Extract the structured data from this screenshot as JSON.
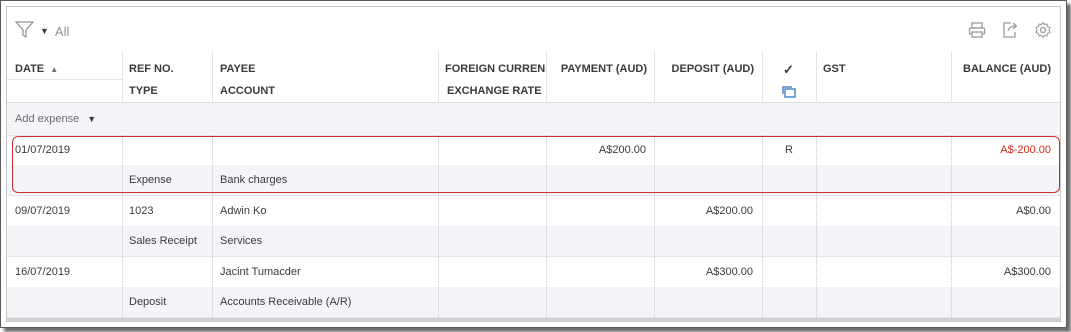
{
  "toolbar": {
    "filter_label": "All",
    "icons": [
      "filter-icon",
      "print-icon",
      "export-icon",
      "settings-gear-icon"
    ]
  },
  "columns": {
    "date": "DATE",
    "sort_indicator": "▲",
    "ref_no": "REF NO.",
    "type": "TYPE",
    "payee": "PAYEE",
    "account": "ACCOUNT",
    "foreign_currency": "FOREIGN CURRENC",
    "exchange_rate": "EXCHANGE RATE",
    "payment": "PAYMENT (AUD)",
    "deposit": "DEPOSIT (AUD)",
    "cleared": "✓",
    "gst": "GST",
    "balance": "BALANCE (AUD)"
  },
  "add_expense": {
    "label": "Add expense"
  },
  "rows": [
    {
      "date": "01/07/2019",
      "ref_no": "",
      "type": "Expense",
      "payee": "",
      "account": "Bank charges",
      "payment": "A$200.00",
      "deposit": "",
      "cleared": "R",
      "gst": "",
      "balance": "A$-200.00",
      "selected": true
    },
    {
      "date": "09/07/2019",
      "ref_no": "1023",
      "type": "Sales Receipt",
      "payee": "Adwin Ko",
      "account": "Services",
      "payment": "",
      "deposit": "A$200.00",
      "cleared": "",
      "gst": "",
      "balance": "A$0.00",
      "selected": false
    },
    {
      "date": "16/07/2019",
      "ref_no": "",
      "type": "Deposit",
      "payee": "Jacint Tumacder",
      "account": "Accounts Receivable (A/R)",
      "payment": "",
      "deposit": "A$300.00",
      "cleared": "",
      "gst": "",
      "balance": "A$300.00",
      "selected": false
    }
  ],
  "colors": {
    "negative": "#d52b1e",
    "selection_border": "#c9302c",
    "text": "#393a3d",
    "muted": "#8d9096"
  }
}
